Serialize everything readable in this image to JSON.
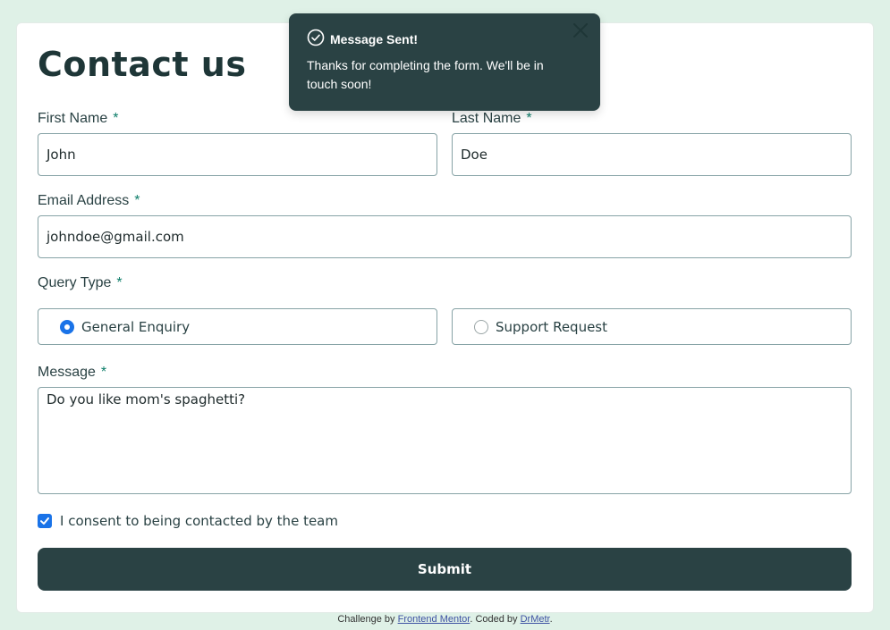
{
  "form": {
    "title": "Contact us",
    "required_mark": "*",
    "first_name": {
      "label": "First Name",
      "value": "John"
    },
    "last_name": {
      "label": "Last Name",
      "value": "Doe"
    },
    "email": {
      "label": "Email Address",
      "value": "johndoe@gmail.com"
    },
    "query_type": {
      "label": "Query Type",
      "options": [
        {
          "label": "General Enquiry",
          "selected": true
        },
        {
          "label": "Support Request",
          "selected": false
        }
      ]
    },
    "message": {
      "label": "Message",
      "value": "Do you like mom's spaghetti?"
    },
    "consent": {
      "label": "I consent to being contacted by the team",
      "checked": true
    },
    "submit_label": "Submit"
  },
  "toast": {
    "title": "Message Sent!",
    "message": "Thanks for completing the form. We'll be in touch soon!",
    "icon": "check-circle-icon"
  },
  "footer": {
    "prefix": "Challenge by",
    "link1": "Frontend Mentor",
    "middle": ". Coded by",
    "link2": "DrMetr",
    "suffix": "."
  },
  "colors": {
    "background": "#dff1e7",
    "primary_dark": "#2a4244",
    "accent_green": "#0c7d69",
    "radio_blue": "#1a73e8"
  }
}
